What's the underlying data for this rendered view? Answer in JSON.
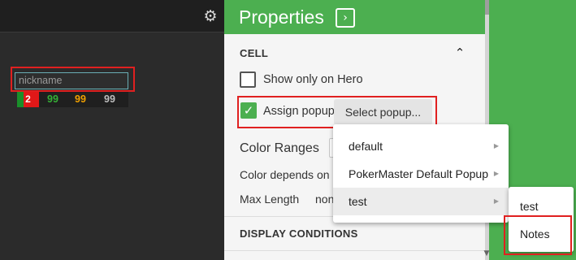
{
  "hud": {
    "nickname_placeholder": "nickname",
    "stats": [
      "2",
      "99",
      "99",
      "99"
    ],
    "colors": {
      "stat_2": "#35b035",
      "stat_3": "#f0a000",
      "stat_4": "#bdbdbd"
    }
  },
  "panel": {
    "title": "Properties",
    "section_cell": "CELL",
    "show_only_on_hero": "Show only on Hero",
    "show_only_on_hero_checked": false,
    "assign_popup": "Assign popup",
    "assign_popup_checked": true,
    "select_popup_button": "Select popup...",
    "color_ranges": "Color Ranges",
    "color_depends_on": "Color depends on",
    "max_length": "Max Length",
    "max_length_value": "non",
    "section_display": "DISPLAY CONDITIONS",
    "accent": "#4caf50"
  },
  "popup_menu": {
    "items": [
      "default",
      "PokerMaster Default Popup",
      "test"
    ],
    "highlighted": "test"
  },
  "submenu": {
    "items": [
      "test",
      "Notes"
    ]
  },
  "icons": {
    "gear": "gear-icon",
    "expand": "chevron-right-icon",
    "collapse": "chevron-up-icon",
    "check": "check-icon",
    "submenu_arrow": "triangle-right-icon"
  }
}
